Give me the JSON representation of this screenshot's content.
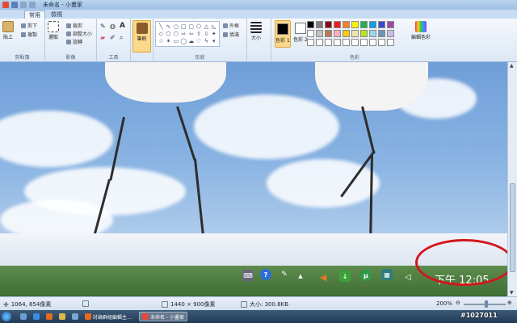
{
  "window": {
    "title": "未命名 - 小畫家"
  },
  "tabs": [
    {
      "label": "常用",
      "active": true
    },
    {
      "label": "檢視",
      "active": false
    }
  ],
  "ribbon": {
    "clipboard": {
      "paste": "貼上",
      "cut": "剪下",
      "copy": "複製",
      "group": "剪貼簿"
    },
    "image": {
      "select": "選取",
      "crop": "裁剪",
      "resize": "調整大小",
      "rotate": "旋轉",
      "group": "影像"
    },
    "tools": {
      "group": "工具"
    },
    "brushes": {
      "label": "筆刷"
    },
    "shapes": {
      "outline": "外框",
      "fill": "填滿",
      "group": "形狀"
    },
    "size": {
      "label": "大小"
    },
    "colors": {
      "color1": "色彩 1",
      "color2": "色彩 2",
      "edit": "編輯色彩",
      "group": "色彩"
    }
  },
  "palette": [
    "#000000",
    "#7f7f7f",
    "#880015",
    "#ed1c24",
    "#ff7f27",
    "#fff200",
    "#22b14c",
    "#00a2e8",
    "#3f48cc",
    "#a349a4",
    "#ffffff",
    "#c3c3c3",
    "#b97a57",
    "#ffaec9",
    "#ffc90e",
    "#efe4b0",
    "#b5e61d",
    "#99d9ea",
    "#7092be",
    "#c8bfe7",
    "#ffffff",
    "#ffffff",
    "#ffffff",
    "#ffffff",
    "#ffffff",
    "#ffffff",
    "#ffffff",
    "#ffffff",
    "#ffffff",
    "#ffffff"
  ],
  "colors": {
    "color1": "#000000",
    "color2": "#ffffff",
    "accent_circle": "#d2161c"
  },
  "canvas_screenshot": {
    "clock": "下午 12:05"
  },
  "status": {
    "cursor": "1064, 854像素",
    "dimensions": "1440 × 900像素",
    "filesize": "大小: 300.8KB",
    "zoom": "200%"
  },
  "taskbar": {
    "items": [
      {
        "label": "討論群組編輯主...",
        "active": false
      },
      {
        "label": "未命名 - 小畫家",
        "active": true
      }
    ],
    "watermark": "#1027011"
  }
}
